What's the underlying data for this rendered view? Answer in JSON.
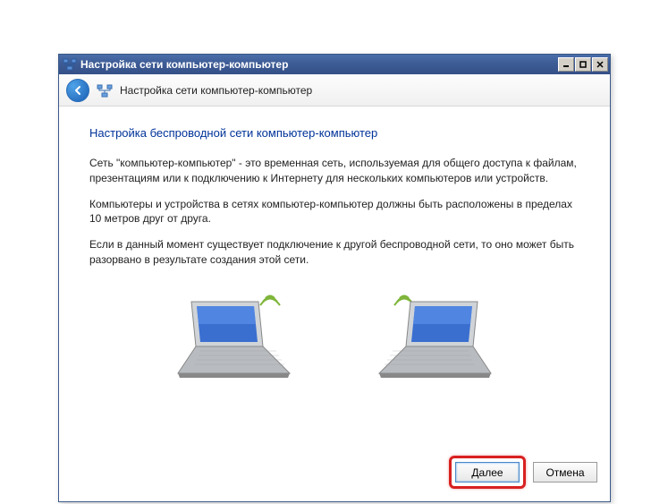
{
  "titlebar": {
    "title": "Настройка сети компьютер-компьютер"
  },
  "header": {
    "title": "Настройка сети компьютер-компьютер"
  },
  "content": {
    "heading": "Настройка беспроводной сети компьютер-компьютер",
    "paragraph1": "Сеть \"компьютер-компьютер\" - это временная сеть, используемая для общего доступа к файлам, презентациям или к подключению к Интернету для нескольких компьютеров или устройств.",
    "paragraph2": "Компьютеры и устройства в сетях компьютер-компьютер должны быть расположены в пределах 10 метров друг от друга.",
    "paragraph3": "Если в данный момент существует подключение к другой беспроводной сети, то оно может быть разорвано в результате создания этой сети."
  },
  "footer": {
    "next_label": "Далее",
    "cancel_label": "Отмена"
  }
}
